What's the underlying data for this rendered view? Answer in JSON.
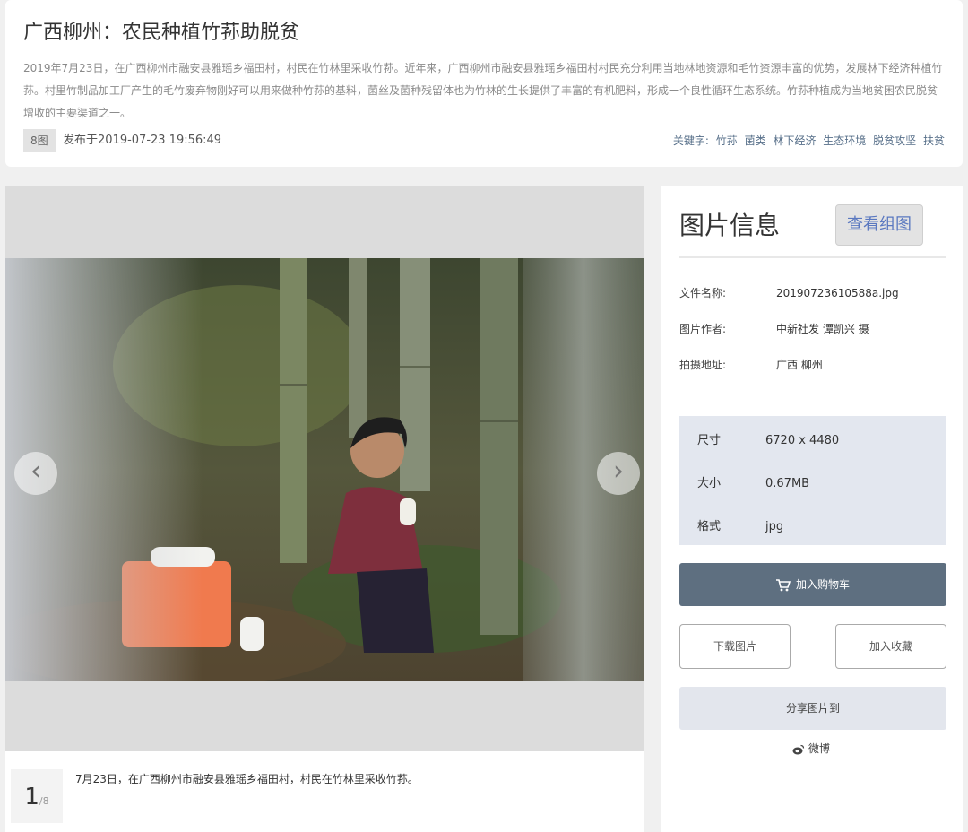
{
  "header": {
    "title": "广西柳州：农民种植竹荪助脱贫",
    "description": "2019年7月23日，在广西柳州市融安县雅瑶乡福田村，村民在竹林里采收竹荪。近年来，广西柳州市融安县雅瑶乡福田村村民充分利用当地林地资源和毛竹资源丰富的优势，发展林下经济种植竹荪。村里竹制品加工厂产生的毛竹废弃物刚好可以用来做种竹荪的基料，菌丝及菌种残留体也为竹林的生长提供了丰富的有机肥料，形成一个良性循环生态系统。竹荪种植成为当地贫困农民脱贫增收的主要渠道之一。",
    "image_count_badge": "8图",
    "publish_time": "发布于2019-07-23 19:56:49",
    "keywords_label": "关键字:",
    "keywords": [
      "竹荪",
      "菌类",
      "林下经济",
      "生态环境",
      "脱贫攻坚",
      "扶贫"
    ]
  },
  "viewer": {
    "prev_icon": "chevron-left-icon",
    "next_icon": "chevron-right-icon",
    "page_current": "1",
    "page_total": "/8",
    "caption": "7月23日，在广西柳州市融安县雅瑶乡福田村，村民在竹林里采收竹荪。"
  },
  "info": {
    "title": "图片信息",
    "view_group_label": "查看组图",
    "meta": [
      {
        "key": "文件名称:",
        "value": "20190723610588a.jpg"
      },
      {
        "key": "图片作者:",
        "value": "中新社发 谭凯兴 摄"
      },
      {
        "key": "拍摄地址:",
        "value": "广西 柳州"
      }
    ],
    "specs": [
      {
        "key": "尺寸",
        "value": "6720 x 4480"
      },
      {
        "key": "大小",
        "value": "0.67MB"
      },
      {
        "key": "格式",
        "value": "jpg"
      }
    ],
    "cart_label": "加入购物车",
    "download_label": "下载图片",
    "favorite_label": "加入收藏",
    "share_label": "分享图片到",
    "weibo_label": "微博"
  }
}
